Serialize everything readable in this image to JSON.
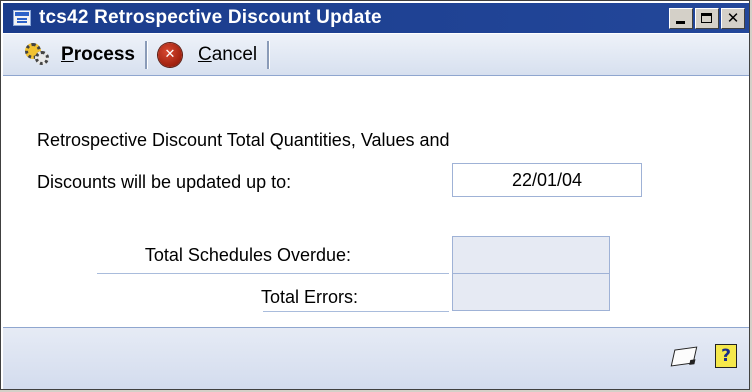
{
  "window": {
    "title": "tcs42 Retrospective Discount Update",
    "controls": {
      "minimize": "_",
      "maximize": "□",
      "close": "✕"
    }
  },
  "toolbar": {
    "process": {
      "hotkey": "P",
      "rest": "rocess",
      "icon": "gears-icon"
    },
    "cancel": {
      "hotkey": "C",
      "rest": "ancel",
      "icon": "cancel-icon",
      "glyph": "✕"
    }
  },
  "form": {
    "line1": "Retrospective Discount Total Quantities, Values and",
    "line2": "Discounts will be updated up to:",
    "date_value": "22/01/04",
    "total_schedules_overdue_label": "Total Schedules Overdue:",
    "total_schedules_overdue_value": "",
    "total_errors_label": "Total Errors:",
    "total_errors_value": ""
  },
  "footer": {
    "note_icon": "note-icon",
    "help_icon": "help-icon",
    "help_glyph": "?"
  }
}
